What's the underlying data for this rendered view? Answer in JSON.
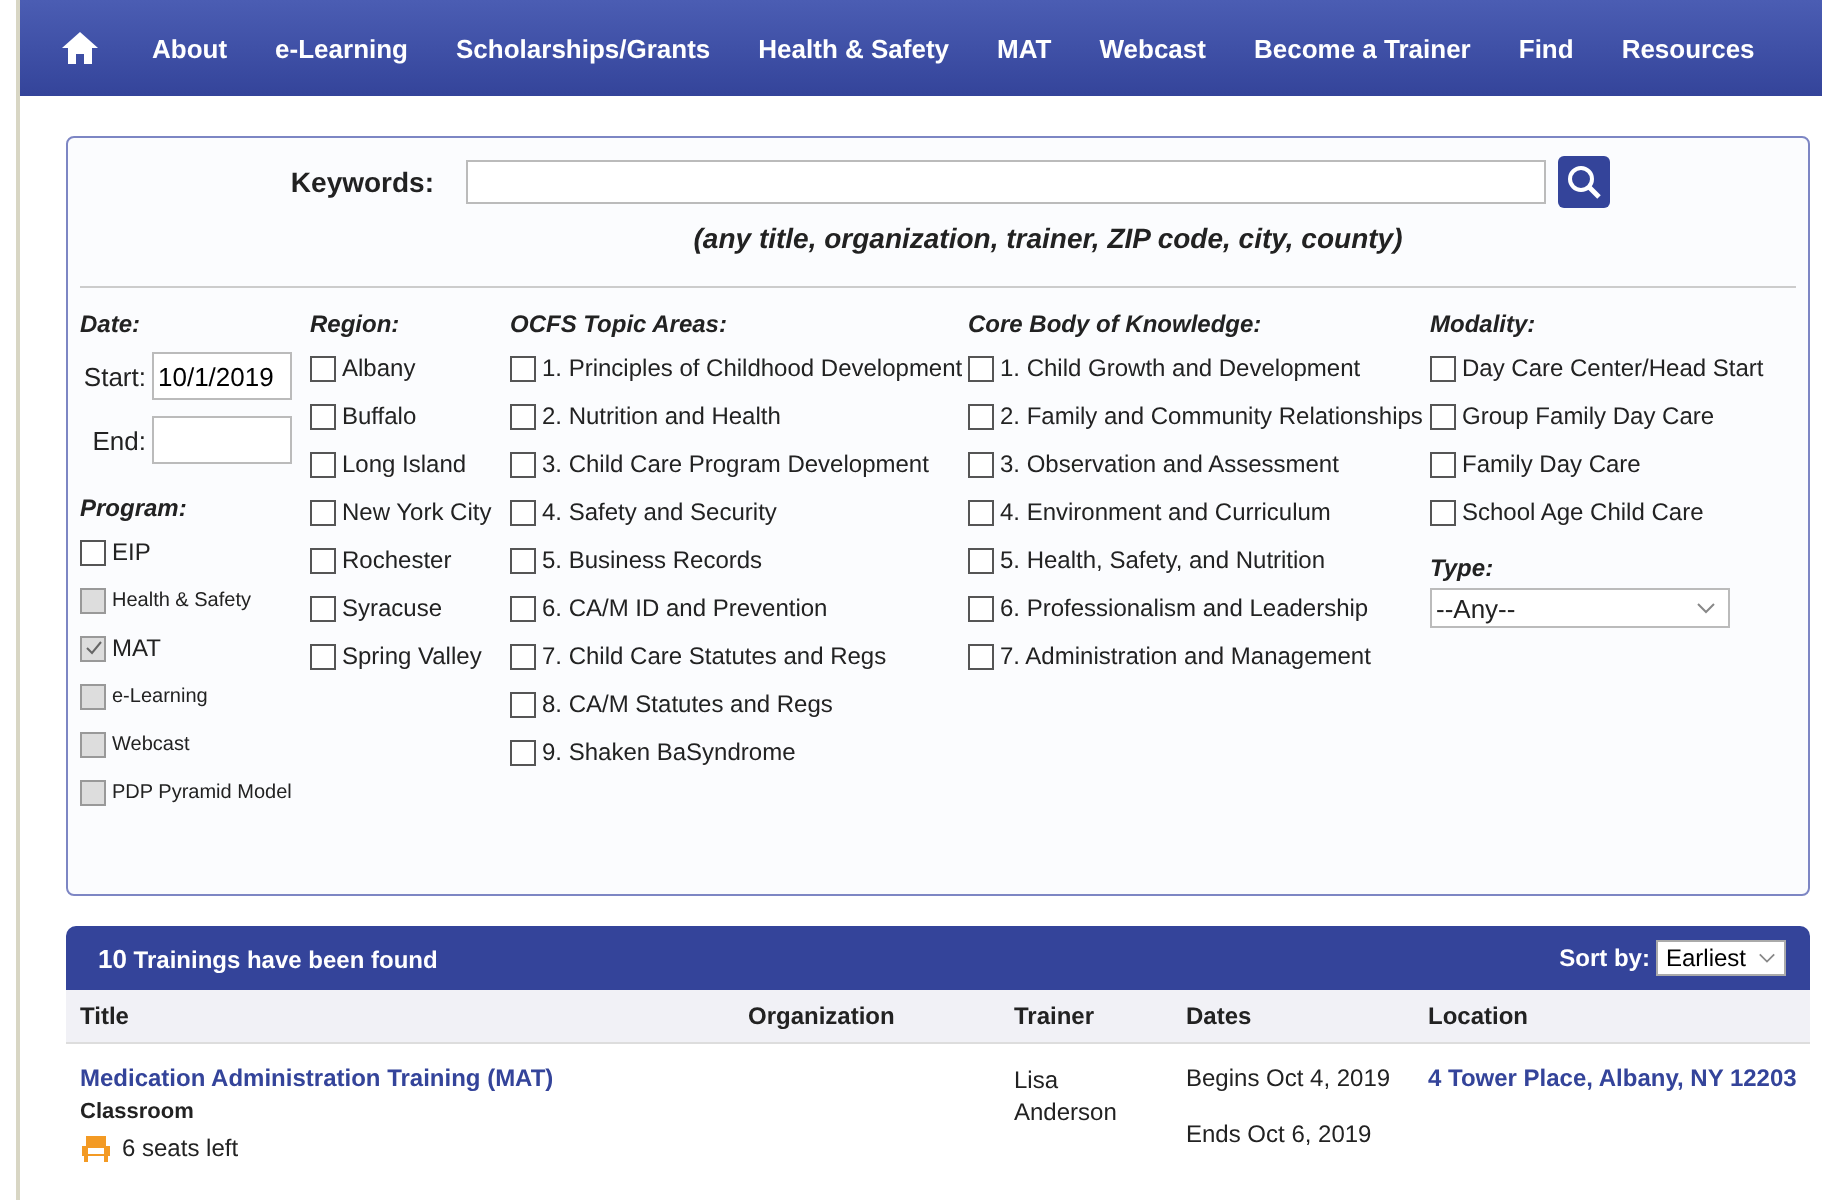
{
  "nav": {
    "items": [
      "About",
      "e-Learning",
      "Scholarships/Grants",
      "Health & Safety",
      "MAT",
      "Webcast",
      "Become a Trainer",
      "Find",
      "Resources"
    ]
  },
  "search": {
    "label": "Keywords:",
    "hint": "(any title, organization, trainer, ZIP code, city, county)"
  },
  "date": {
    "heading": "Date:",
    "start_label": "Start:",
    "start_value": "10/1/2019",
    "end_label": "End:"
  },
  "program": {
    "heading": "Program:",
    "items": [
      {
        "label": "EIP",
        "checked": false,
        "disabled": false,
        "kind": "normal"
      },
      {
        "label": "Health & Safety",
        "checked": false,
        "disabled": true,
        "kind": "minor"
      },
      {
        "label": "MAT",
        "checked": true,
        "disabled": true,
        "kind": "normal"
      },
      {
        "label": "e-Learning",
        "checked": false,
        "disabled": true,
        "kind": "minor"
      },
      {
        "label": "Webcast",
        "checked": false,
        "disabled": true,
        "kind": "minor"
      },
      {
        "label": "PDP Pyramid Model",
        "checked": false,
        "disabled": true,
        "kind": "minor"
      }
    ]
  },
  "region": {
    "heading": "Region:",
    "items": [
      {
        "label": "Albany",
        "checked": false
      },
      {
        "label": "Buffalo",
        "checked": false
      },
      {
        "label": "Long Island",
        "checked": false
      },
      {
        "label": "New York City",
        "checked": false
      },
      {
        "label": "Rochester",
        "checked": false
      },
      {
        "label": "Syracuse",
        "checked": false
      },
      {
        "label": "Spring Valley",
        "checked": false
      }
    ]
  },
  "topics": {
    "heading": "OCFS Topic Areas:",
    "items": [
      {
        "label": "1. Principles of Childhood Development",
        "checked": false
      },
      {
        "label": "2. Nutrition and Health",
        "checked": false
      },
      {
        "label": "3. Child Care Program Development",
        "checked": false
      },
      {
        "label": "4. Safety and Security",
        "checked": false
      },
      {
        "label": "5. Business Records",
        "checked": false
      },
      {
        "label": "6. CA/M ID and Prevention",
        "checked": false
      },
      {
        "label": "7. Child Care Statutes and Regs",
        "checked": false
      },
      {
        "label": "8. CA/M Statutes and Regs",
        "checked": false
      },
      {
        "label": "9. Shaken BaSyndrome",
        "checked": false
      }
    ]
  },
  "core": {
    "heading": "Core Body of Knowledge:",
    "items": [
      {
        "label": "1. Child Growth and Development",
        "checked": false
      },
      {
        "label": "2. Family and Community Relationships",
        "checked": false
      },
      {
        "label": "3. Observation and Assessment",
        "checked": false
      },
      {
        "label": "4. Environment and Curriculum",
        "checked": false
      },
      {
        "label": "5. Health, Safety, and Nutrition",
        "checked": false
      },
      {
        "label": "6. Professionalism and Leadership",
        "checked": false
      },
      {
        "label": "7. Administration and Management",
        "checked": false
      }
    ]
  },
  "modality": {
    "heading": "Modality:",
    "items": [
      {
        "label": "Day Care Center/Head Start",
        "checked": false
      },
      {
        "label": "Group Family Day Care",
        "checked": false
      },
      {
        "label": "Family Day Care",
        "checked": false
      },
      {
        "label": "School Age Child Care",
        "checked": false
      }
    ]
  },
  "type": {
    "heading": "Type:",
    "value": "--Any--"
  },
  "results": {
    "count": "10",
    "title": "Trainings have been found",
    "sort_label": "Sort by:",
    "sort_value": "Earliest",
    "columns": [
      "Title",
      "Organization",
      "Trainer",
      "Dates",
      "Location"
    ],
    "rows": [
      {
        "title": "Medication Administration Training (MAT)",
        "format": "Classroom",
        "seats": "6 seats left",
        "trainer": "Lisa Anderson",
        "begins": "Begins Oct 4, 2019",
        "ends": "Ends Oct 6, 2019",
        "location": "4 Tower Place, Albany, NY 12203"
      }
    ]
  }
}
